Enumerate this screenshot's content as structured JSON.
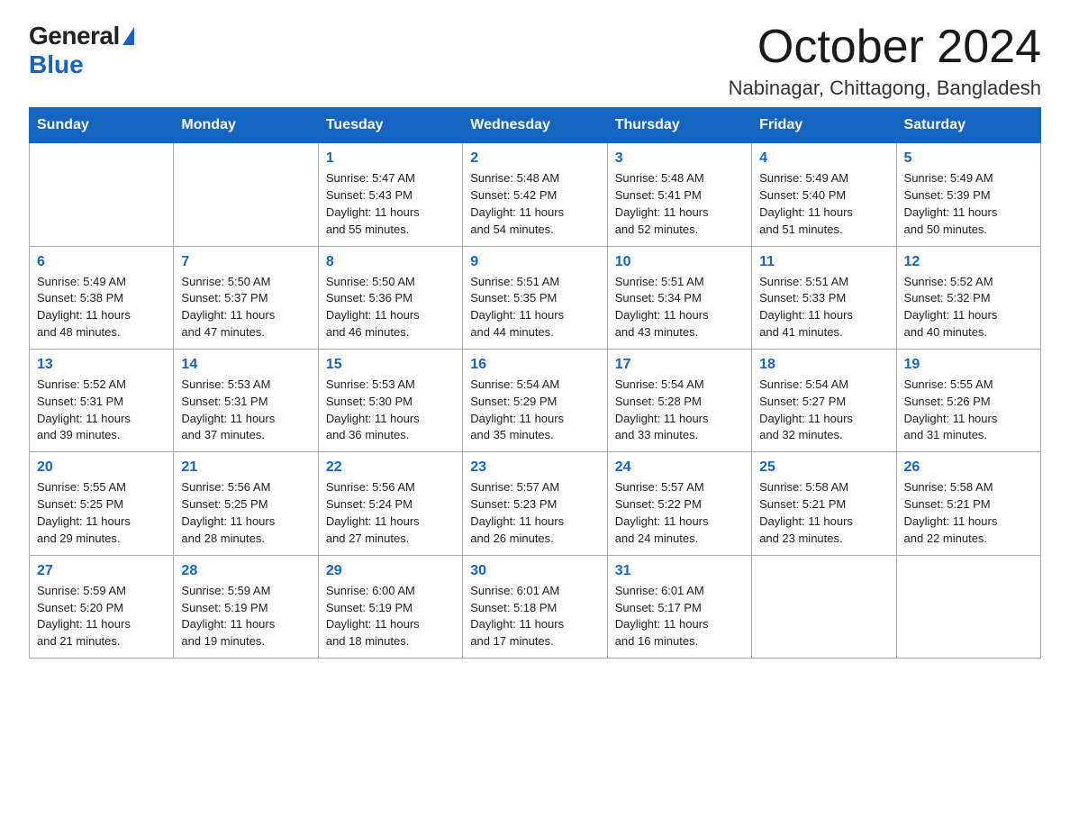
{
  "header": {
    "logo_general": "General",
    "logo_blue": "Blue",
    "month_title": "October 2024",
    "location": "Nabinagar, Chittagong, Bangladesh"
  },
  "days_of_week": [
    "Sunday",
    "Monday",
    "Tuesday",
    "Wednesday",
    "Thursday",
    "Friday",
    "Saturday"
  ],
  "weeks": [
    [
      {
        "day": "",
        "info": ""
      },
      {
        "day": "",
        "info": ""
      },
      {
        "day": "1",
        "info": "Sunrise: 5:47 AM\nSunset: 5:43 PM\nDaylight: 11 hours\nand 55 minutes."
      },
      {
        "day": "2",
        "info": "Sunrise: 5:48 AM\nSunset: 5:42 PM\nDaylight: 11 hours\nand 54 minutes."
      },
      {
        "day": "3",
        "info": "Sunrise: 5:48 AM\nSunset: 5:41 PM\nDaylight: 11 hours\nand 52 minutes."
      },
      {
        "day": "4",
        "info": "Sunrise: 5:49 AM\nSunset: 5:40 PM\nDaylight: 11 hours\nand 51 minutes."
      },
      {
        "day": "5",
        "info": "Sunrise: 5:49 AM\nSunset: 5:39 PM\nDaylight: 11 hours\nand 50 minutes."
      }
    ],
    [
      {
        "day": "6",
        "info": "Sunrise: 5:49 AM\nSunset: 5:38 PM\nDaylight: 11 hours\nand 48 minutes."
      },
      {
        "day": "7",
        "info": "Sunrise: 5:50 AM\nSunset: 5:37 PM\nDaylight: 11 hours\nand 47 minutes."
      },
      {
        "day": "8",
        "info": "Sunrise: 5:50 AM\nSunset: 5:36 PM\nDaylight: 11 hours\nand 46 minutes."
      },
      {
        "day": "9",
        "info": "Sunrise: 5:51 AM\nSunset: 5:35 PM\nDaylight: 11 hours\nand 44 minutes."
      },
      {
        "day": "10",
        "info": "Sunrise: 5:51 AM\nSunset: 5:34 PM\nDaylight: 11 hours\nand 43 minutes."
      },
      {
        "day": "11",
        "info": "Sunrise: 5:51 AM\nSunset: 5:33 PM\nDaylight: 11 hours\nand 41 minutes."
      },
      {
        "day": "12",
        "info": "Sunrise: 5:52 AM\nSunset: 5:32 PM\nDaylight: 11 hours\nand 40 minutes."
      }
    ],
    [
      {
        "day": "13",
        "info": "Sunrise: 5:52 AM\nSunset: 5:31 PM\nDaylight: 11 hours\nand 39 minutes."
      },
      {
        "day": "14",
        "info": "Sunrise: 5:53 AM\nSunset: 5:31 PM\nDaylight: 11 hours\nand 37 minutes."
      },
      {
        "day": "15",
        "info": "Sunrise: 5:53 AM\nSunset: 5:30 PM\nDaylight: 11 hours\nand 36 minutes."
      },
      {
        "day": "16",
        "info": "Sunrise: 5:54 AM\nSunset: 5:29 PM\nDaylight: 11 hours\nand 35 minutes."
      },
      {
        "day": "17",
        "info": "Sunrise: 5:54 AM\nSunset: 5:28 PM\nDaylight: 11 hours\nand 33 minutes."
      },
      {
        "day": "18",
        "info": "Sunrise: 5:54 AM\nSunset: 5:27 PM\nDaylight: 11 hours\nand 32 minutes."
      },
      {
        "day": "19",
        "info": "Sunrise: 5:55 AM\nSunset: 5:26 PM\nDaylight: 11 hours\nand 31 minutes."
      }
    ],
    [
      {
        "day": "20",
        "info": "Sunrise: 5:55 AM\nSunset: 5:25 PM\nDaylight: 11 hours\nand 29 minutes."
      },
      {
        "day": "21",
        "info": "Sunrise: 5:56 AM\nSunset: 5:25 PM\nDaylight: 11 hours\nand 28 minutes."
      },
      {
        "day": "22",
        "info": "Sunrise: 5:56 AM\nSunset: 5:24 PM\nDaylight: 11 hours\nand 27 minutes."
      },
      {
        "day": "23",
        "info": "Sunrise: 5:57 AM\nSunset: 5:23 PM\nDaylight: 11 hours\nand 26 minutes."
      },
      {
        "day": "24",
        "info": "Sunrise: 5:57 AM\nSunset: 5:22 PM\nDaylight: 11 hours\nand 24 minutes."
      },
      {
        "day": "25",
        "info": "Sunrise: 5:58 AM\nSunset: 5:21 PM\nDaylight: 11 hours\nand 23 minutes."
      },
      {
        "day": "26",
        "info": "Sunrise: 5:58 AM\nSunset: 5:21 PM\nDaylight: 11 hours\nand 22 minutes."
      }
    ],
    [
      {
        "day": "27",
        "info": "Sunrise: 5:59 AM\nSunset: 5:20 PM\nDaylight: 11 hours\nand 21 minutes."
      },
      {
        "day": "28",
        "info": "Sunrise: 5:59 AM\nSunset: 5:19 PM\nDaylight: 11 hours\nand 19 minutes."
      },
      {
        "day": "29",
        "info": "Sunrise: 6:00 AM\nSunset: 5:19 PM\nDaylight: 11 hours\nand 18 minutes."
      },
      {
        "day": "30",
        "info": "Sunrise: 6:01 AM\nSunset: 5:18 PM\nDaylight: 11 hours\nand 17 minutes."
      },
      {
        "day": "31",
        "info": "Sunrise: 6:01 AM\nSunset: 5:17 PM\nDaylight: 11 hours\nand 16 minutes."
      },
      {
        "day": "",
        "info": ""
      },
      {
        "day": "",
        "info": ""
      }
    ]
  ]
}
